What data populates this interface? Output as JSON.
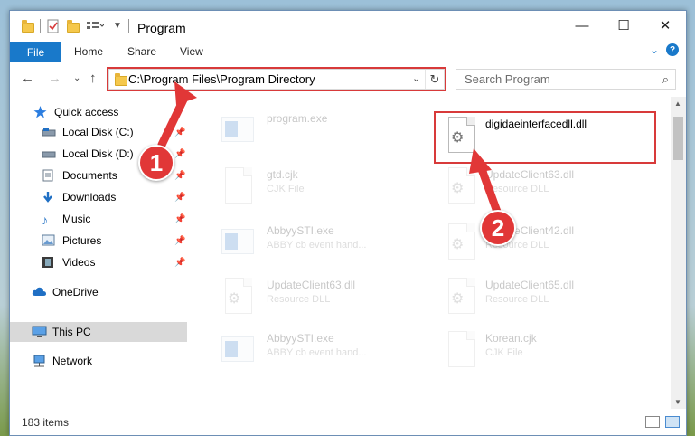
{
  "window": {
    "title": "Program"
  },
  "ribbon": {
    "file": "File",
    "tabs": [
      "Home",
      "Share",
      "View"
    ]
  },
  "address": {
    "path": "C:\\Program Files\\Program Directory",
    "search_placeholder": "Search Program"
  },
  "sidebar": {
    "items": [
      {
        "label": "Quick access",
        "icon": "star-icon",
        "pinned": false
      },
      {
        "label": "Local Disk (C:)",
        "icon": "drive-icon",
        "pinned": true
      },
      {
        "label": "Local Disk (D:)",
        "icon": "drive-icon",
        "pinned": true
      },
      {
        "label": "Documents",
        "icon": "documents-icon",
        "pinned": true
      },
      {
        "label": "Downloads",
        "icon": "download-icon",
        "pinned": true
      },
      {
        "label": "Music",
        "icon": "music-icon",
        "pinned": true
      },
      {
        "label": "Pictures",
        "icon": "pictures-icon",
        "pinned": true
      },
      {
        "label": "Videos",
        "icon": "videos-icon",
        "pinned": true
      },
      {
        "label": "OneDrive",
        "icon": "cloud-icon",
        "pinned": false
      },
      {
        "label": "This PC",
        "icon": "computer-icon",
        "pinned": false
      },
      {
        "label": "Network",
        "icon": "network-icon",
        "pinned": false
      }
    ]
  },
  "files": [
    {
      "name": "program.exe",
      "type": "",
      "kind": "exe",
      "highlighted": false
    },
    {
      "name": "digidaeinterfacedll.dll",
      "type": "",
      "kind": "dll",
      "highlighted": true
    },
    {
      "name": "gtd.cjk",
      "type": "CJK File",
      "kind": "doc",
      "highlighted": false
    },
    {
      "name": "UpdateClient63.dll",
      "type": "Resource DLL",
      "kind": "dll",
      "highlighted": false
    },
    {
      "name": "AbbyySTI.exe",
      "type": "ABBY cb event hand...",
      "kind": "app",
      "highlighted": false
    },
    {
      "name": "UpdateClient42.dll",
      "type": "Resource DLL",
      "kind": "dll",
      "highlighted": false
    },
    {
      "name": "UpdateClient63.dll",
      "type": "Resource DLL",
      "kind": "dll",
      "highlighted": false
    },
    {
      "name": "UpdateClient65.dll",
      "type": "Resource DLL",
      "kind": "dll",
      "highlighted": false
    },
    {
      "name": "AbbyySTI.exe",
      "type": "ABBY cb event hand...",
      "kind": "app",
      "highlighted": false
    },
    {
      "name": "Korean.cjk",
      "type": "CJK File",
      "kind": "doc",
      "highlighted": false
    }
  ],
  "annotations": {
    "step1": "1",
    "step2": "2",
    "color": "#e13737"
  },
  "status": {
    "count": "183 items"
  }
}
